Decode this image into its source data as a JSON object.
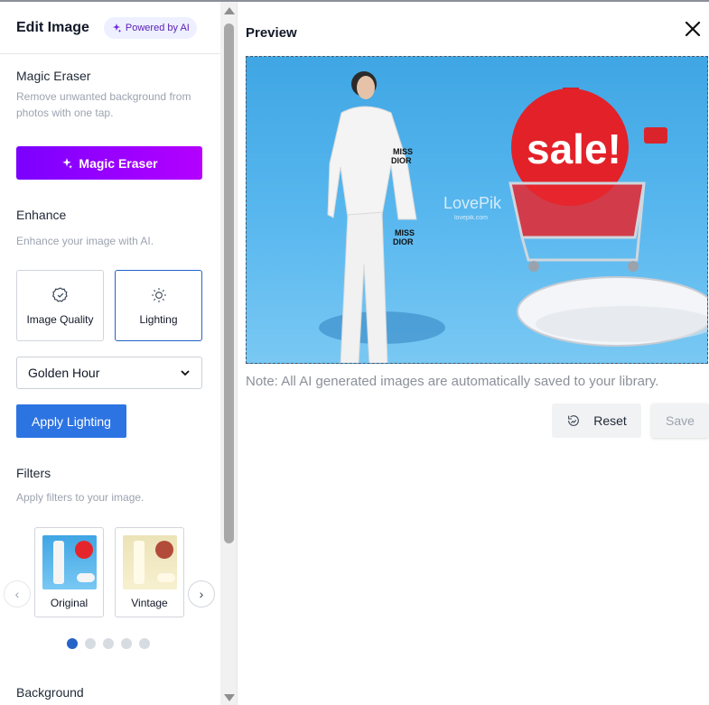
{
  "header": {
    "title": "Edit Image",
    "badge": "Powered by AI"
  },
  "magic_eraser": {
    "title": "Magic Eraser",
    "description": "Remove unwanted background from photos with one tap.",
    "button": "Magic Eraser"
  },
  "enhance": {
    "title": "Enhance",
    "description": "Enhance your image with AI.",
    "options": [
      {
        "label": "Image Quality",
        "icon": "badge-check-icon",
        "selected": false
      },
      {
        "label": "Lighting",
        "icon": "sun-icon",
        "selected": true
      }
    ],
    "select_value": "Golden Hour",
    "apply_button": "Apply Lighting"
  },
  "filters": {
    "title": "Filters",
    "description": "Apply filters to your image.",
    "items": [
      {
        "label": "Original"
      },
      {
        "label": "Vintage"
      }
    ],
    "prev": "‹",
    "next": "›",
    "page_count": 5,
    "active_page": 1
  },
  "background": {
    "title": "Background"
  },
  "preview": {
    "title": "Preview",
    "note": "Note: All AI generated images are automatically saved to your library.",
    "reset_button": "Reset",
    "save_button": "Save",
    "image": {
      "sale_text": "sale!",
      "watermark": "LovePik",
      "watermark_small": "lovepik.com",
      "tag_text": "MISS DIOR"
    }
  },
  "colors": {
    "accent": "#2d74e3",
    "magic_gradient_start": "#7b00ff",
    "magic_gradient_end": "#b400ff",
    "sky": "#4fb0ea"
  }
}
